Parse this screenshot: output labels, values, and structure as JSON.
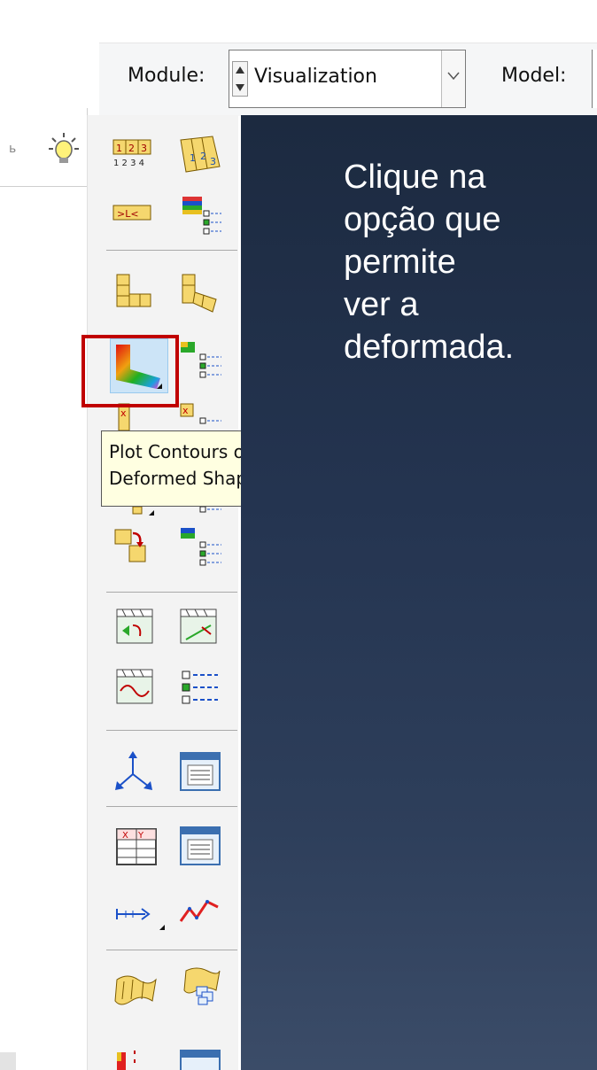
{
  "module_bar": {
    "module_label": "Module:",
    "module_value": "Visualization",
    "model_label": "Model:"
  },
  "left_panel": {
    "glyph": "ь"
  },
  "toolbox": {
    "tools": [
      {
        "icon": "common-options-numbering-icon"
      },
      {
        "icon": "superimpose-options-icon"
      },
      {
        "icon": "view-cut-icon"
      },
      {
        "icon": "color-code-options-icon"
      },
      {
        "icon": "plot-undeformed-shape-icon"
      },
      {
        "icon": "plot-deformed-shape-icon"
      },
      {
        "icon": "plot-contours-on-deformed-shape-icon"
      },
      {
        "icon": "contour-options-icon"
      },
      {
        "icon": "plot-symbols-icon"
      },
      {
        "icon": "symbol-options-icon"
      },
      {
        "icon": "allow-multiple-plot-states-icon"
      },
      {
        "icon": "overlay-options-icon"
      },
      {
        "icon": "animate-scale-factor-icon"
      },
      {
        "icon": "animate-time-history-icon"
      },
      {
        "icon": "animate-harmonic-icon"
      },
      {
        "icon": "animation-options-icon"
      },
      {
        "icon": "create-coordinate-system-icon"
      },
      {
        "icon": "report-field-output-icon"
      },
      {
        "icon": "create-xy-data-icon"
      },
      {
        "icon": "report-xy-icon"
      },
      {
        "icon": "create-path-icon"
      },
      {
        "icon": "xy-plot-icon"
      },
      {
        "icon": "create-display-group-icon"
      },
      {
        "icon": "replace-display-group-icon"
      },
      {
        "icon": "query-icon"
      },
      {
        "icon": "report-icon"
      }
    ]
  },
  "tooltip": {
    "text": "Plot Contours on\nDeformed Shape"
  },
  "viewport": {
    "instruction": "Clique na\nopção que\npermite\nver a\ndeformada."
  },
  "colors": {
    "viewport_top": "#1c2a40",
    "viewport_bottom": "#3b4c68",
    "highlight": "#c00000",
    "tooltip_bg": "#ffffe1",
    "selected_tool_bg": "#cce4f7"
  }
}
